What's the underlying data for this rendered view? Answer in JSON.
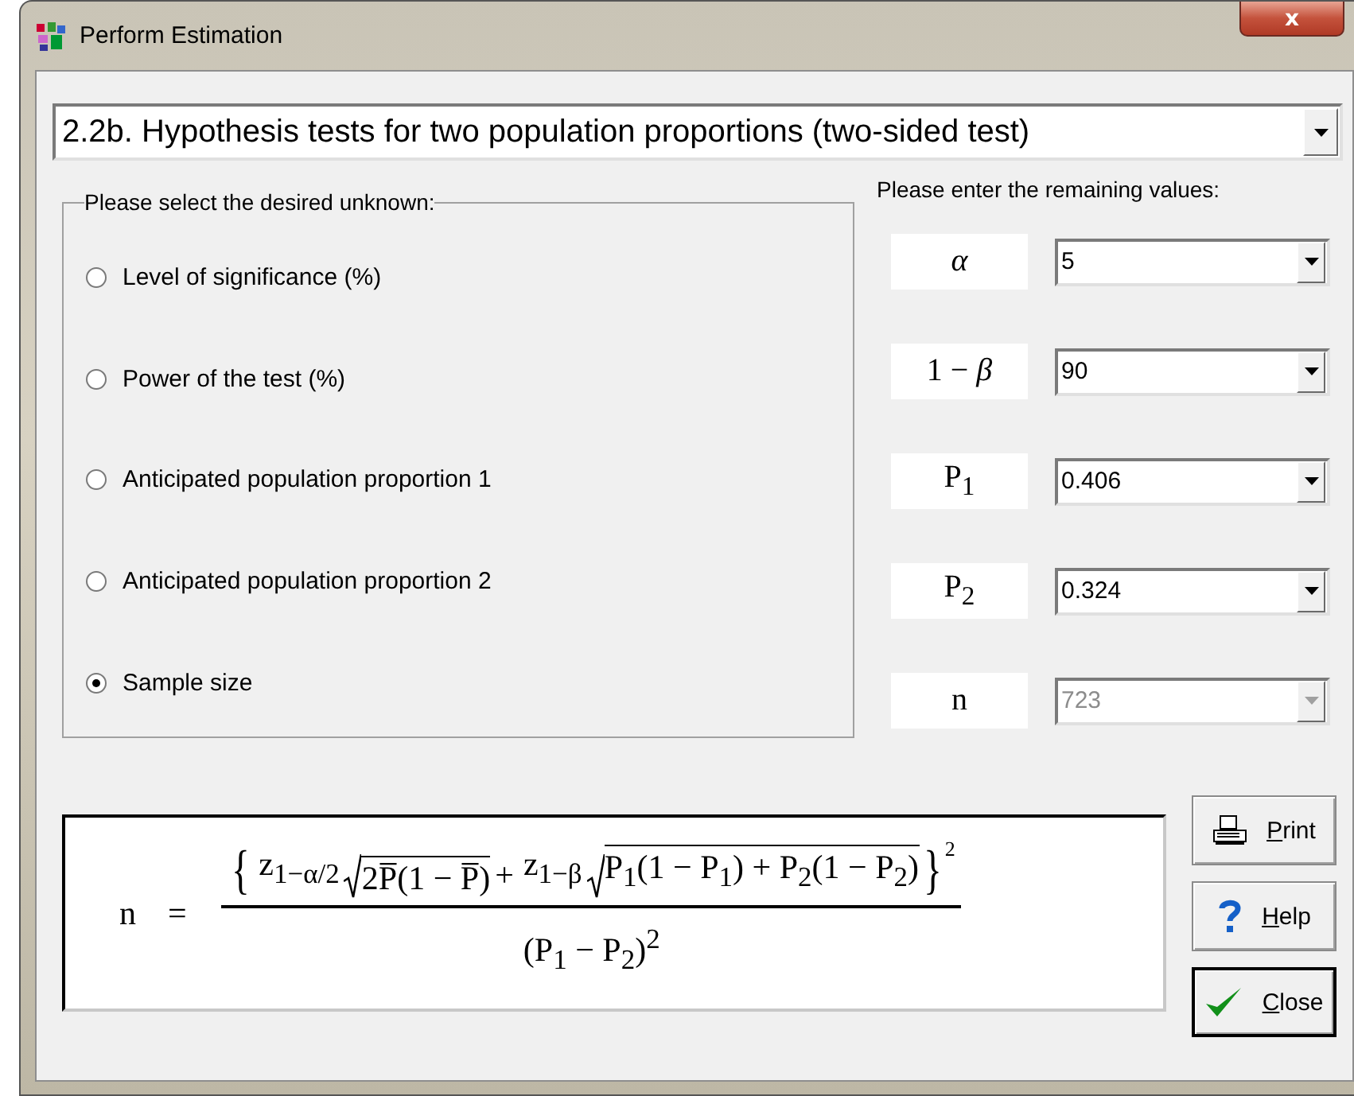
{
  "window": {
    "title": "Perform Estimation",
    "close_label": "x"
  },
  "test_selector": {
    "value": "2.2b.  Hypothesis tests for two population proportions (two-sided test)"
  },
  "unknown_group": {
    "title": "Please select the desired unknown:",
    "options": [
      {
        "label": "Level of significance (%)",
        "selected": false
      },
      {
        "label": "Power of the test (%)",
        "selected": false
      },
      {
        "label": "Anticipated population proportion 1",
        "selected": false
      },
      {
        "label": "Anticipated population proportion 2",
        "selected": false
      },
      {
        "label": "Sample size",
        "selected": true
      }
    ]
  },
  "values_group": {
    "title": "Please enter the remaining values:",
    "rows": [
      {
        "symbol": "*α*",
        "value": "5",
        "disabled": false
      },
      {
        "symbol": "1 − *β*",
        "value": "90",
        "disabled": false
      },
      {
        "symbol": "P$_{1}$",
        "value": "0.406",
        "disabled": false
      },
      {
        "symbol": "P$_{2}$",
        "value": "0.324",
        "disabled": false
      },
      {
        "symbol": "n",
        "value": "723",
        "disabled": true
      }
    ]
  },
  "formula": {
    "lhs": "n",
    "equals": "=",
    "open_brace": "{",
    "close_brace": "}",
    "term_1": "z$_{1−α/2}$",
    "radicand_1": "2P̅(1 − P̅)",
    "plus": "+",
    "term_2": "z$_{1−β}$",
    "radicand_2": "P$_{1}$(1 − P$_{1}$) + P$_{2}$(1 − P$_{2}$)",
    "exponent": "2",
    "denominator": "(P$_{1}$ − P$_{2}$)$^{2}$"
  },
  "buttons": [
    {
      "kind": "print",
      "label": "Print"
    },
    {
      "kind": "help",
      "label": "Help"
    },
    {
      "kind": "close",
      "label": "Close"
    }
  ]
}
